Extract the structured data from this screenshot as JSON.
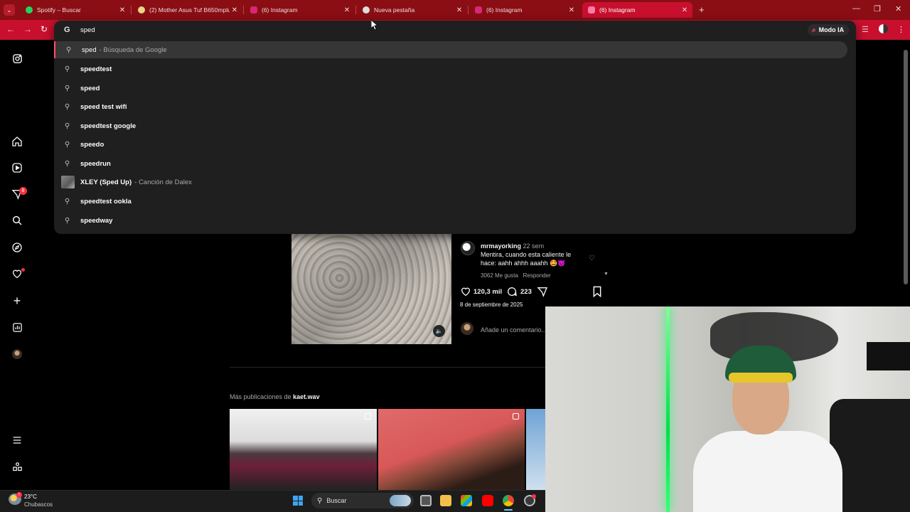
{
  "tabs": [
    {
      "title": "Spotify – Buscar",
      "favicon_color": "#1ed760"
    },
    {
      "title": "(2) Mother Asus Tuf B650mplus",
      "favicon_color": "#e6d48a"
    },
    {
      "title": "(6) Instagram",
      "favicon_color": "#d62976"
    },
    {
      "title": "Nueva pestaña",
      "favicon_color": "#dddddd"
    },
    {
      "title": "(6) Instagram",
      "favicon_color": "#d62976"
    },
    {
      "title": "(6) Instagram",
      "favicon_color": "#d62976"
    }
  ],
  "omnibox": {
    "query": "sped",
    "modo_ia_label": "Modo IA",
    "suggestions": [
      {
        "text": "sped",
        "subtitle": "- Búsqueda de Google",
        "selected": true
      },
      {
        "text": "speedtest"
      },
      {
        "text": "speed"
      },
      {
        "text": "speed test wifi"
      },
      {
        "text": "speedtest google"
      },
      {
        "text": "speedo"
      },
      {
        "text": "speedrun"
      },
      {
        "text": "XLEY (Sped Up)",
        "subtitle": "- Canción de Dalex",
        "has_thumbnail": true
      },
      {
        "text": "speedtest ookla"
      },
      {
        "text": "speedway"
      }
    ]
  },
  "instagram": {
    "notification_count": "8",
    "comment": {
      "user": "mrmayorking",
      "time": "22 sem",
      "text_line1": "Mentira, cuando esta caliente le",
      "text_line2": "hace: aahh ahhh aaahh 🤩👿",
      "likes": "3062 Me gusta",
      "reply": "Responder"
    },
    "like_count": "120,3 mil",
    "comment_count": "223",
    "date": "8 de septiembre de 2025",
    "add_comment_placeholder": "Añade un comentario...",
    "more_posts_prefix": "Más publicaciones de",
    "more_posts_user": "kaet.wav"
  },
  "taskbar": {
    "temperature": "23°C",
    "condition": "Chubascos",
    "search_label": "Buscar"
  },
  "colors": {
    "tab_bar": "#8a0e14",
    "toolbar": "#c8102e",
    "accent": "#ff4d6d",
    "instagram_badge": "#ff3040"
  }
}
